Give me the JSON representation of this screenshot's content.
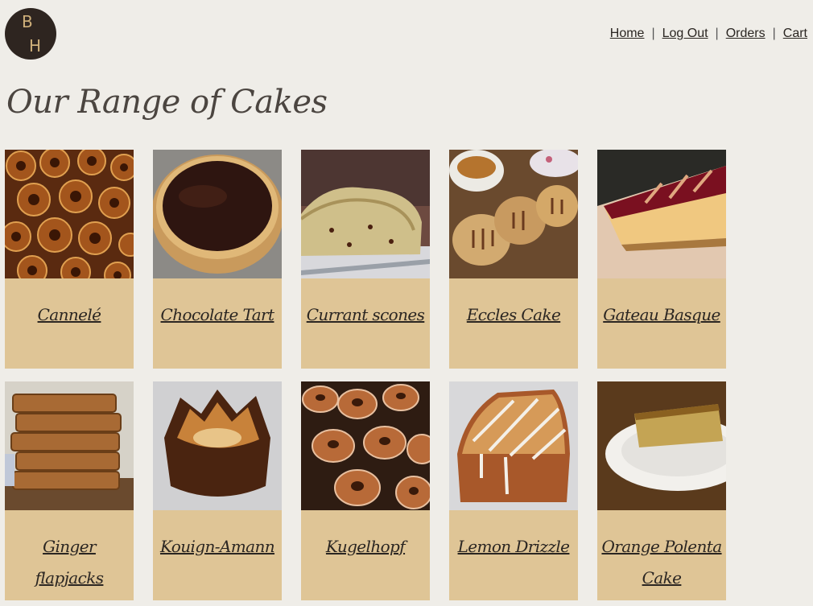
{
  "logo": {
    "line1": "B",
    "line2": "H"
  },
  "nav": {
    "home": "Home",
    "logout": "Log Out",
    "orders": "Orders",
    "cart": "Cart",
    "separator": "|"
  },
  "page": {
    "title": "Our Range of Cakes"
  },
  "cakes": [
    {
      "name": "Cannelé",
      "image": "canneles-image"
    },
    {
      "name": "Chocolate Tart",
      "image": "chocolate-tart-image"
    },
    {
      "name": "Currant scones",
      "image": "currant-scone-image"
    },
    {
      "name": "Eccles Cake",
      "image": "eccles-cake-image"
    },
    {
      "name": "Gateau Basque",
      "image": "gateau-basque-image"
    },
    {
      "name": "Ginger flapjacks",
      "image": "ginger-flapjacks-image"
    },
    {
      "name": "Kouign-Amann",
      "image": "kouign-amann-image"
    },
    {
      "name": "Kugelhopf",
      "image": "kugelhopf-image"
    },
    {
      "name": "Lemon Drizzle",
      "image": "lemon-drizzle-image"
    },
    {
      "name": "Orange Polenta Cake",
      "image": "orange-polenta-image"
    }
  ],
  "colors": {
    "background": "#efede8",
    "card": "#dfc596",
    "logo_bg": "#2e2520",
    "logo_text": "#cfb07a"
  }
}
